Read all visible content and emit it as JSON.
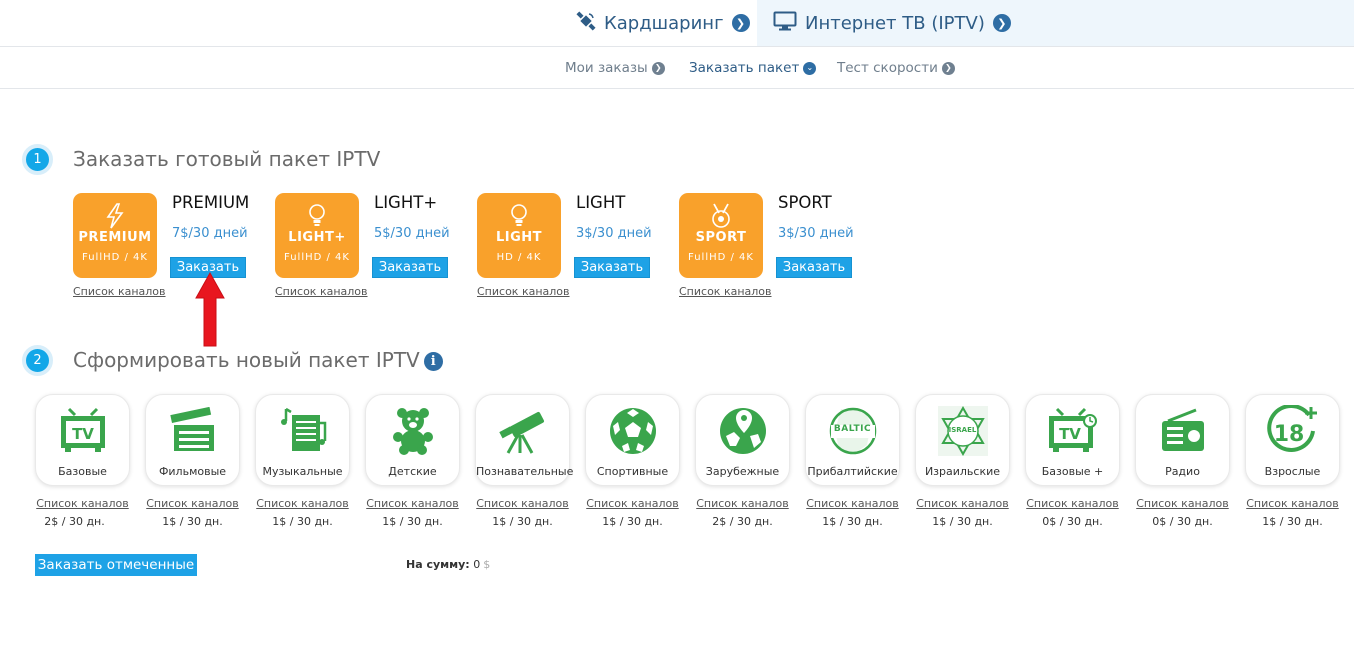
{
  "topnav": {
    "cardsharing": "Кардшаринг",
    "iptv": "Интернет ТВ (IPTV)"
  },
  "subnav": {
    "my_orders": "Мои заказы",
    "order_package": "Заказать пакет",
    "speed_test": "Тест скорости"
  },
  "section1": {
    "number": "1",
    "title": "Заказать готовый пакет IPTV"
  },
  "section2": {
    "number": "2",
    "title": "Сформировать новый пакет IPTV"
  },
  "packages": [
    {
      "icon": "lightning-icon",
      "badge": "PREMIUM",
      "quality": "FullHD / 4K",
      "title": "PREMIUM",
      "price": "7$/30 дней",
      "button": "Заказать",
      "link": "Список каналов"
    },
    {
      "icon": "lightbulb-icon",
      "badge": "LIGHT+",
      "quality": "FullHD / 4K",
      "title": "LIGHT+",
      "price": "5$/30 дней",
      "button": "Заказать",
      "link": "Список каналов"
    },
    {
      "icon": "lightbulb-icon",
      "badge": "LIGHT",
      "quality": "HD / 4K",
      "title": "LIGHT",
      "price": "3$/30 дней",
      "button": "Заказать",
      "link": "Список каналов"
    },
    {
      "icon": "medal-icon",
      "badge": "SPORT",
      "quality": "FullHD / 4K",
      "title": "SPORT",
      "price": "3$/30 дней",
      "button": "Заказать",
      "link": "Список каналов"
    }
  ],
  "categories": [
    {
      "icon": "tv-icon",
      "label": "Базовые",
      "link": "Список каналов",
      "price": "2$ / 30 дн."
    },
    {
      "icon": "clapperboard-icon",
      "label": "Фильмовые",
      "link": "Список каналов",
      "price": "1$ / 30 дн."
    },
    {
      "icon": "music-icon",
      "label": "Музыкальные",
      "link": "Список каналов",
      "price": "1$ / 30 дн."
    },
    {
      "icon": "teddy-bear-icon",
      "label": "Детские",
      "link": "Список каналов",
      "price": "1$ / 30 дн."
    },
    {
      "icon": "telescope-icon",
      "label": "Познавательные",
      "link": "Список каналов",
      "price": "1$ / 30 дн."
    },
    {
      "icon": "soccer-ball-icon",
      "label": "Спортивные",
      "link": "Список каналов",
      "price": "1$ / 30 дн."
    },
    {
      "icon": "globe-pin-icon",
      "label": "Зарубежные",
      "link": "Список каналов",
      "price": "2$ / 30 дн."
    },
    {
      "icon": "baltic-badge-icon",
      "badge": "BALTIC",
      "label": "Прибалтийские",
      "link": "Список каналов",
      "price": "1$ / 30 дн."
    },
    {
      "icon": "israel-star-icon",
      "badge": "ISRAEL",
      "label": "Израильские",
      "link": "Список каналов",
      "price": "1$ / 30 дн."
    },
    {
      "icon": "tv-plus-icon",
      "label": "Базовые +",
      "link": "Список каналов",
      "price": "0$ / 30 дн."
    },
    {
      "icon": "radio-icon",
      "label": "Радио",
      "link": "Список каналов",
      "price": "0$ / 30 дн."
    },
    {
      "icon": "adult-18-icon",
      "label": "Взрослые",
      "link": "Список каналов",
      "price": "1$ / 30 дн."
    }
  ],
  "order_checked_button": "Заказать отмеченные",
  "sum": {
    "label": "На сумму:",
    "value": "0",
    "currency": "$"
  },
  "colors": {
    "accent": "#1ea2e6",
    "orange": "#f9a12b",
    "green": "#3aa54c",
    "nav": "#2e5c86"
  }
}
